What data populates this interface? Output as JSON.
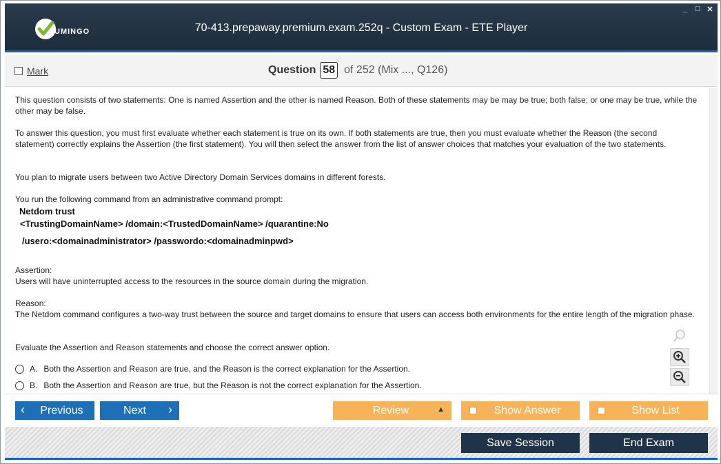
{
  "window": {
    "title": "70-413.prepaway.premium.exam.252q - Custom Exam - ETE Player",
    "logo_text": "UMINGO",
    "controls": [
      "_",
      "□",
      "✕"
    ]
  },
  "header": {
    "mark_label": "Mark",
    "question_label": "Question",
    "question_number": "58",
    "of_text": "of 252 (Mix ..., Q126)"
  },
  "question": {
    "intro1": "This question consists of two statements: One is named Assertion and the other is named Reason. Both of these statements may be may be true; both false; or one may be true, while the other may be false.",
    "intro2": "To answer this question, you must first evaluate whether each statement is true on its own. If both statements are true, then you must evaluate whether the Reason (the second statement) correctly explains the Assertion (the first statement). You will then select the answer from the list of answer choices that matches your evaluation of the two statements.",
    "scenario": "You plan to migrate users between two Active Directory Domain Services domains in different forests.",
    "command_intro": "You run the following command from an administrative command prompt:",
    "cmd_line1": "Netdom trust",
    "cmd_line2": "<TrustingDomainName> /domain:<TrustedDomainName> /quarantine:No",
    "cmd_line3": "/usero:<domainadministrator> /passwordo:<domainadminpwd>",
    "assertion_label": "Assertion:",
    "assertion_text": "Users will have uninterrupted access to the resources in the source domain during the migration.",
    "reason_label": "Reason:",
    "reason_text": "The Netdom command configures a two-way trust between the source and target domains to ensure that users can access both environments for the entire length of the migration phase.",
    "instruction": "Evaluate the Assertion and Reason statements and choose the correct answer option.",
    "options": [
      {
        "letter": "A.",
        "text": "Both the Assertion and Reason are true, and the Reason is the correct explanation for the Assertion."
      },
      {
        "letter": "B.",
        "text": "Both the Assertion and Reason are true, but the Reason is not the correct explanation for the Assertion."
      }
    ]
  },
  "nav": {
    "previous": "Previous",
    "next": "Next",
    "review": "Review",
    "show_answer": "Show Answer",
    "show_list": "Show List"
  },
  "footer": {
    "save_session": "Save Session",
    "end_exam": "End Exam"
  },
  "colors": {
    "titlebar": "#1e2d3c",
    "accent_blue": "#1e6fb6",
    "accent_orange": "#f7b35a",
    "dark_button": "#1f3349"
  },
  "icons": [
    "checkmark-logo-icon",
    "search-icon",
    "zoom-in-icon",
    "zoom-out-icon",
    "chevron-left-icon",
    "chevron-right-icon",
    "triangle-up-icon"
  ]
}
